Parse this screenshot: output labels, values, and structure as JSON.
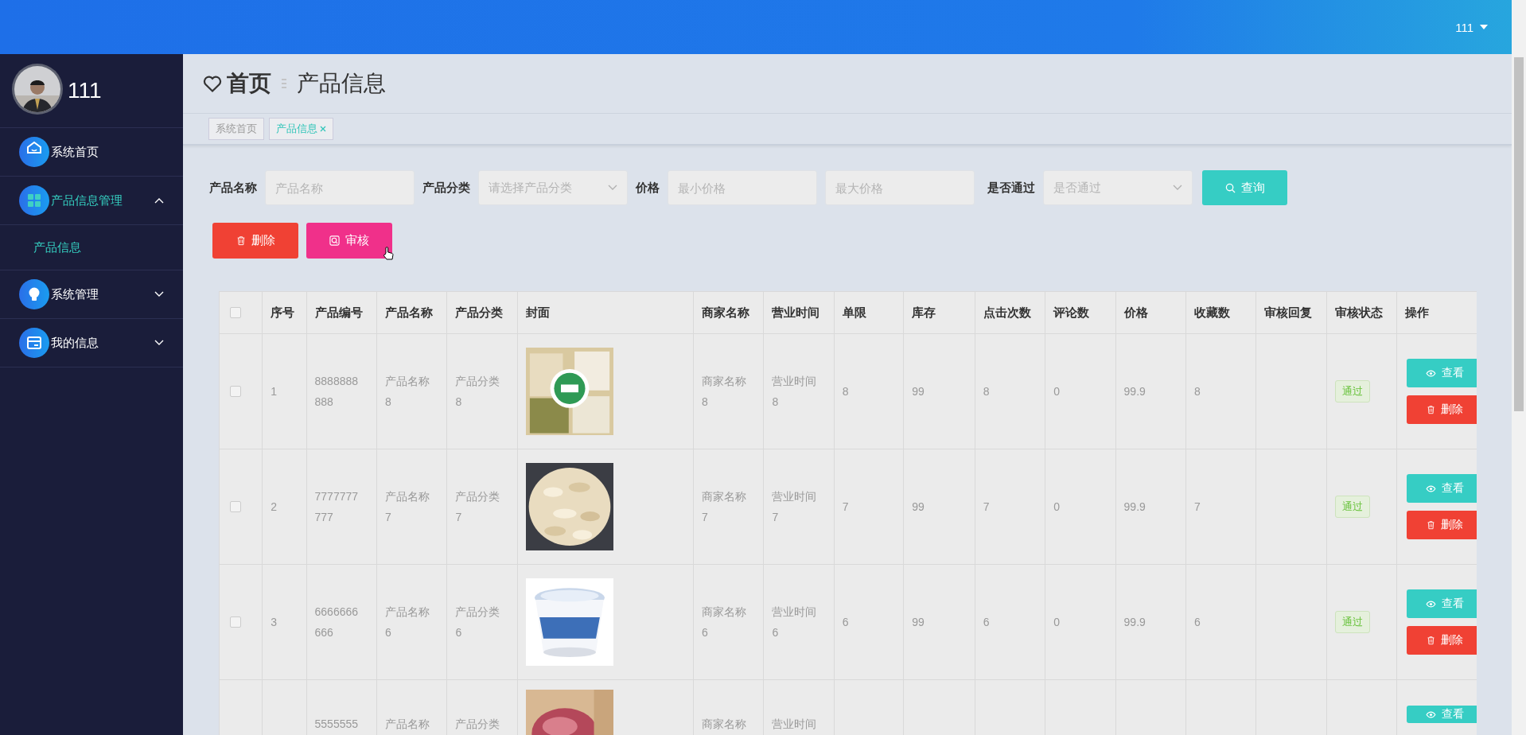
{
  "top_bar": {
    "user": "111"
  },
  "sidebar": {
    "user_name": "111",
    "items": [
      {
        "label": "系统首页",
        "kind": "link",
        "selected": false
      },
      {
        "label": "产品信息管理",
        "kind": "group",
        "selected": true,
        "expanded": true,
        "children": [
          {
            "label": "产品信息",
            "selected": true
          }
        ]
      },
      {
        "label": "系统管理",
        "kind": "group",
        "selected": false,
        "expanded": false
      },
      {
        "label": "我的信息",
        "kind": "group",
        "selected": false,
        "expanded": false
      }
    ]
  },
  "header": {
    "home": "首页",
    "title": "产品信息"
  },
  "tabs": [
    {
      "label": "系统首页",
      "selected": false
    },
    {
      "label": "产品信息",
      "selected": true
    }
  ],
  "filters": [
    {
      "label": "产品名称",
      "kind": "input",
      "placeholder": "产品名称"
    },
    {
      "label": "产品分类",
      "kind": "select",
      "placeholder": "请选择产品分类"
    },
    {
      "label": "价格",
      "kind": "input",
      "placeholder": "最小价格"
    },
    {
      "kind": "input",
      "placeholder": "最大价格"
    },
    {
      "label": "是否通过",
      "kind": "select",
      "placeholder": "是否通过"
    }
  ],
  "search_button": "查询",
  "actions": [
    {
      "label": "删除",
      "kind": "delete"
    },
    {
      "label": "审核",
      "kind": "review"
    }
  ],
  "table": {
    "all_checked": false,
    "columns": [
      "序号",
      "产品编号",
      "产品名称",
      "产品分类",
      "封面",
      "商家名称",
      "营业时间",
      "单限",
      "库存",
      "点击次数",
      "评论数",
      "价格",
      "收藏数",
      "审核回复",
      "审核状态",
      "操作"
    ],
    "rows": [
      {
        "checked": false,
        "cells": [
          "1",
          "8888888888",
          "产品名称8",
          "产品分类8",
          "",
          "商家名称8",
          "营业时间8",
          "8",
          "99",
          "8",
          "0",
          "99.9",
          "8",
          ""
        ],
        "status": "通过",
        "buttons": [
          "查看",
          "删除"
        ]
      },
      {
        "checked": false,
        "cells": [
          "2",
          "7777777777",
          "产品名称7",
          "产品分类7",
          "",
          "商家名称7",
          "营业时间7",
          "7",
          "99",
          "7",
          "0",
          "99.9",
          "7",
          ""
        ],
        "status": "通过",
        "buttons": [
          "查看",
          "删除"
        ]
      },
      {
        "checked": false,
        "cells": [
          "3",
          "6666666666",
          "产品名称6",
          "产品分类6",
          "",
          "商家名称6",
          "营业时间6",
          "6",
          "99",
          "6",
          "0",
          "99.9",
          "6",
          ""
        ],
        "status": "通过",
        "buttons": [
          "查看",
          "删除"
        ]
      },
      {
        "cells": [
          "",
          "5555555",
          "产品名称",
          "产品分类",
          "",
          "商家名称",
          "营业时间",
          "",
          "",
          "",
          "",
          "",
          "",
          ""
        ],
        "buttons": [
          "查看"
        ]
      }
    ]
  }
}
